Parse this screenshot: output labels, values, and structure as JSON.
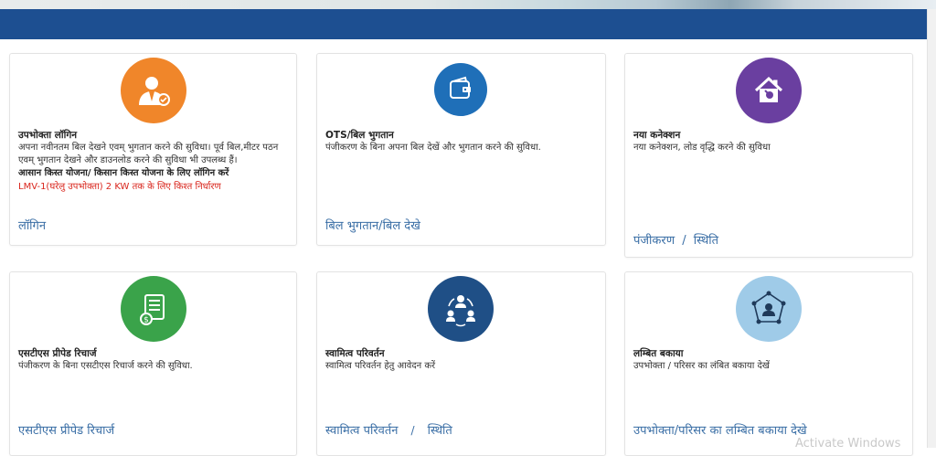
{
  "colors": {
    "header_blue": "#1d4f91",
    "link_blue": "#3b6fa6",
    "alert_red": "#d9251c"
  },
  "cards": [
    {
      "title": "उपभोक्ता लॉगिन",
      "icon": "consumer-login-icon",
      "icon_color": "#f0862a",
      "desc": "अपना नवीनतम बिल देखने एवम् भुगतान करने की सुविधा। पूर्व बिल,मीटर पठन एवम् भुगतान देखने और डाउनलोड करने की सुविधा भी उपलब्ध हैं।",
      "emph": "आसान किस्त योजना/ किसान किस्त योजना के लिए लॉगिन करें",
      "red": "LMV-1(घरेलु उपभोक्ता) 2 KW तक के लिए किश्त निर्धारण",
      "link": "लॉगिन"
    },
    {
      "title": "OTS/बिल भुगतान",
      "icon": "wallet-icon",
      "icon_color": "#1f6fb8",
      "desc": "पंजीकरण के बिना अपना बिल देखें और भुगतान करने की सुविधा.",
      "link": "बिल भुगतान/बिल देखे"
    },
    {
      "title": "नया कनेक्शन",
      "icon": "new-connection-house-icon",
      "icon_color": "#6a3fa0",
      "desc": "नया कनेक्शन, लोड वृद्धि करने की सुविधा",
      "link_a": "पंजीकरण",
      "link_b": "स्थिति",
      "link_sep": "/"
    },
    {
      "title": "एसटीएस प्रीपेड रिचार्ज",
      "icon": "prepaid-document-icon",
      "icon_color": "#3aa34a",
      "desc": "पंजीकरण के बिना एसटीएस रिचार्ज करने की सुविधा.",
      "link": "एसटीएस प्रीपेड रिचार्ज"
    },
    {
      "title": "स्वामित्व परिवर्तन",
      "icon": "ownership-transfer-icon",
      "icon_color": "#1f4f86",
      "desc": "स्वामित्व परिवर्तन हेतु आवेदन करें",
      "link_a": "स्वामित्व परिवर्तन",
      "link_b": "स्थिति",
      "link_sep": "/"
    },
    {
      "title": "लम्बित बकाया",
      "icon": "pending-dues-network-icon",
      "icon_color": "#9fcbe8",
      "desc": "उपभोक्ता / परिसर का लंबित बकाया देखें",
      "link": "उपभोक्ता/परिसर का लम्बित बकाया देखे"
    }
  ],
  "watermark": "Activate Windows"
}
